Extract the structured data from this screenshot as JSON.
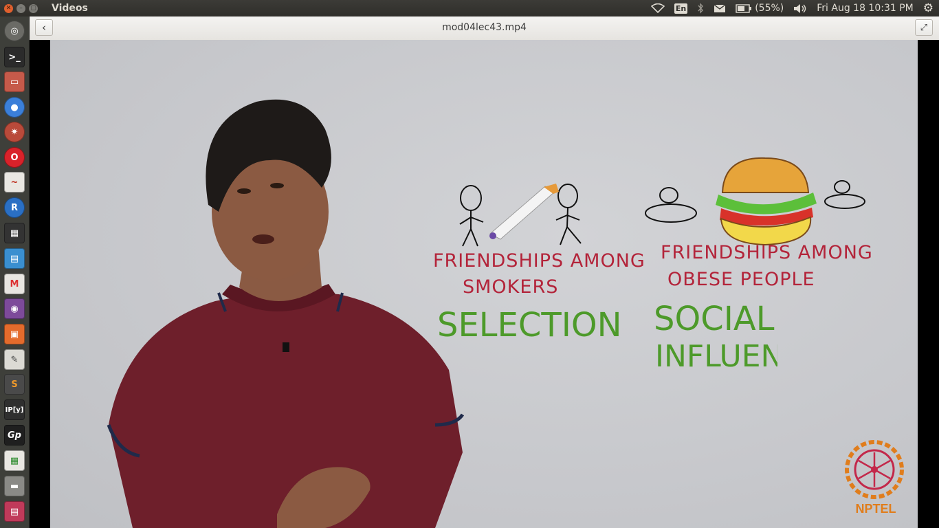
{
  "panel": {
    "app_title": "Videos",
    "keyboard_layout": "En",
    "battery": "(55%)",
    "datetime": "Fri Aug 18 10:31 PM",
    "icons": [
      "wifi-icon",
      "bluetooth-icon",
      "mail-icon",
      "battery-icon",
      "volume-icon",
      "gear-icon"
    ]
  },
  "launcher": {
    "items": [
      "dash-icon",
      "terminal-icon",
      "files-icon",
      "chrome-icon",
      "settings-icon",
      "opera-icon",
      "document-viewer-icon",
      "r-icon",
      "video-editor-icon",
      "text-document-icon",
      "gmail-icon",
      "media-player-icon",
      "presentation-icon",
      "text-editor-icon",
      "sublime-text-icon",
      "ipython-icon",
      "gp-icon",
      "spreadsheet-icon",
      "drive-icon",
      "software-icon"
    ],
    "labels": {
      "r": "R",
      "sublime": "S",
      "ipython": "IP[y]",
      "gp": "Gp"
    }
  },
  "header": {
    "file_title": "mod04lec43.mp4"
  },
  "video": {
    "left_caption_line1": "FRIENDSHIPS AMONG",
    "left_caption_line2": "SMOKERS",
    "left_concept": "SELECTION",
    "right_caption_line1": "FRIENDSHIPS AMONG",
    "right_caption_line2": "OBESE PEOPLE",
    "right_concept_line1": "SOCIAL",
    "right_concept_line2": "INFLUEN",
    "logo_text": "NPTEL"
  },
  "colors": {
    "caption_red": "#b3243a",
    "concept_green": "#4d9a2a",
    "shirt": "#6e1f2b",
    "logo": "#e07d1c"
  }
}
